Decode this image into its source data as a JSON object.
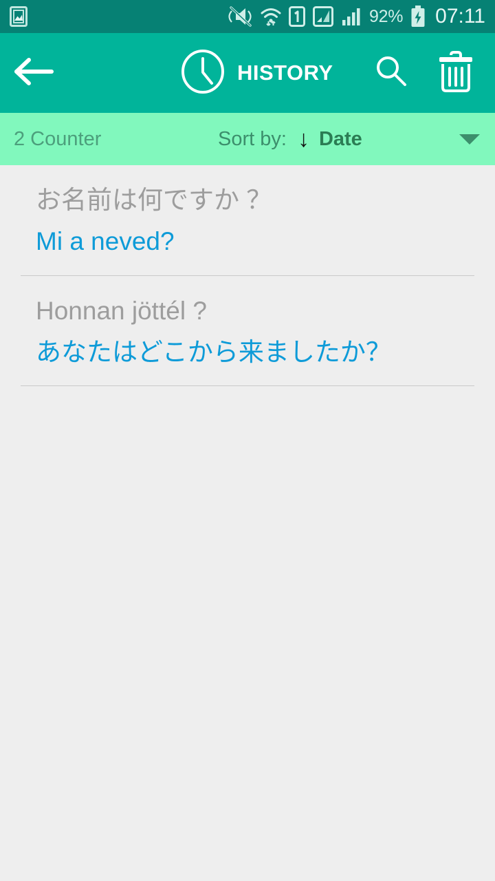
{
  "status_bar": {
    "background": "#068174",
    "left_icons": [
      "photo-gallery-icon"
    ],
    "right_icons": [
      "silent-vibrate-off-icon",
      "wifi-icon",
      "sim-1-icon",
      "signal-sim1-icon",
      "signal-sim2-icon"
    ],
    "battery_percent": "92%",
    "battery_icon": "battery-charging-icon",
    "time": "07:11"
  },
  "app_bar": {
    "background": "#01b49a",
    "back_icon": "arrow-left-icon",
    "title_icon": "clock-icon",
    "title": "HISTORY",
    "actions": [
      {
        "name": "search-icon",
        "label": "Search"
      },
      {
        "name": "trash-icon",
        "label": "Delete all"
      }
    ]
  },
  "sort_bar": {
    "background": "#81f8bd",
    "counter": "2 Counter",
    "sort_by_label": "Sort by:",
    "sort_direction_icon": "arrow-down-icon",
    "sort_value": "Date",
    "dropdown_icon": "caret-down-icon"
  },
  "history": {
    "items": [
      {
        "source": "お名前は何ですか ？",
        "translation": "Mi a neved?"
      },
      {
        "source": "Honnan jöttél ?",
        "translation": "あなたはどこから来ましたか？"
      }
    ]
  },
  "colors": {
    "status_bar": "#068174",
    "app_bar": "#01b49a",
    "sort_bar": "#81f8bd",
    "body_background": "#eeeeee",
    "source_text": "#9d9d9d",
    "translation_text": "#0e9bd8",
    "divider": "#c9c9c9"
  }
}
